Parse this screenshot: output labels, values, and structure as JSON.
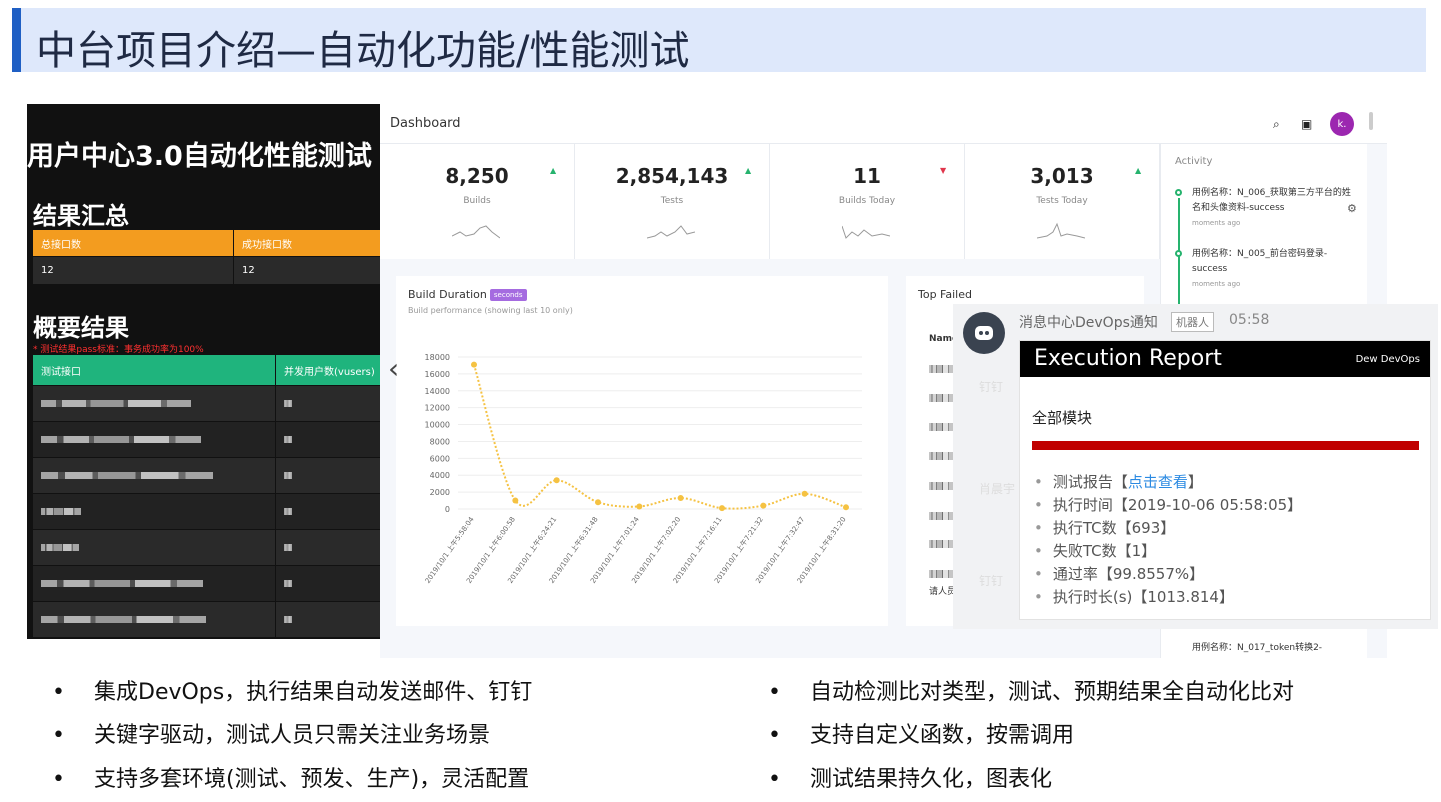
{
  "slide": {
    "title": "中台项目介绍—自动化功能/性能测试"
  },
  "report": {
    "title": "用户中心3.0自动化性能测试",
    "summary_heading": "结果汇总",
    "summary_headers": [
      "总接口数",
      "成功接口数"
    ],
    "summary_values": [
      "12",
      "12"
    ],
    "overview_heading": "概要结果",
    "requirement_note": "* 测试结果pass标准：事务成功率为100%",
    "table_headers": [
      "测试接口",
      "并发用户数(vusers)"
    ],
    "colors": {
      "orange": "#f39c1f",
      "green": "#1fb47d",
      "red": "#ff3030"
    }
  },
  "dashboard": {
    "title": "Dashboard",
    "avatar_initial": "k.",
    "stats": [
      {
        "value": "8,250",
        "label": "Builds",
        "trend": "up"
      },
      {
        "value": "2,854,143",
        "label": "Tests",
        "trend": "up"
      },
      {
        "value": "11",
        "label": "Builds Today",
        "trend": "down"
      },
      {
        "value": "3,013",
        "label": "Tests Today",
        "trend": "up"
      }
    ],
    "activity": {
      "heading": "Activity",
      "items": [
        {
          "text": "用例名称：N_006_获取第三方平台的姓名和头像资料-success",
          "time": "moments ago"
        },
        {
          "text": "用例名称：N_005_前台密码登录-success",
          "time": "moments ago"
        },
        {
          "text": "用例名称：N_017_token转换2-",
          "time": ""
        }
      ]
    },
    "chart_card": {
      "title": "Build Duration",
      "badge": "seconds",
      "subtitle": "Build performance (showing last 10 only)"
    },
    "top_failed": {
      "title": "Top Failed",
      "column": "Name",
      "footer": "请人员"
    }
  },
  "chart_data": {
    "type": "line",
    "title": "Build Duration",
    "x": [
      "2019/10/1 上午5:58:04",
      "2019/10/1 上午6:00:58",
      "2019/10/1 上午6:24:21",
      "2019/10/1 上午6:31:48",
      "2019/10/1 上午7:01:24",
      "2019/10/1 上午7:02:20",
      "2019/10/1 上午7:16:11",
      "2019/10/1 上午7:21:32",
      "2019/10/1 上午7:32:47",
      "2019/10/1 上午8:31:20"
    ],
    "series": [
      {
        "values": [
          17100,
          1000,
          3400,
          800,
          300,
          1300,
          100,
          400,
          1800,
          200
        ],
        "color": "#f5c242"
      }
    ],
    "y_ticks": [
      "0",
      "2000",
      "4000",
      "6000",
      "8000",
      "10000",
      "12000",
      "14000",
      "16000",
      "18000"
    ],
    "ylim": [
      0,
      18000
    ],
    "grid": true
  },
  "notification": {
    "sender": "消息中心DevOps通知",
    "tag": "机器人",
    "time": "05:58",
    "card_title": "Execution Report",
    "brand": "Dew DevOps",
    "module": "全部模块",
    "items": [
      {
        "label": "测试报告【",
        "link": "点击查看",
        "suffix": "】"
      },
      {
        "label": "执行时间【2019-10-06 05:58:05】"
      },
      {
        "label": "执行TC数【693】"
      },
      {
        "label": "失败TC数【1】"
      },
      {
        "label": "通过率【99.8557%】"
      },
      {
        "label": "执行时长(s)【1013.814】"
      }
    ],
    "watermarks": [
      "钉钉",
      "肖晨宇",
      "钉钉"
    ]
  },
  "bullets": {
    "left": [
      "集成DevOps，执行结果自动发送邮件、钉钉",
      "关键字驱动，测试人员只需关注业务场景",
      "支持多套环境(测试、预发、生产)，灵活配置"
    ],
    "right": [
      "自动检测比对类型，测试、预期结果全自动化比对",
      "支持自定义函数，按需调用",
      "测试结果持久化，图表化"
    ],
    "marker": "•"
  }
}
